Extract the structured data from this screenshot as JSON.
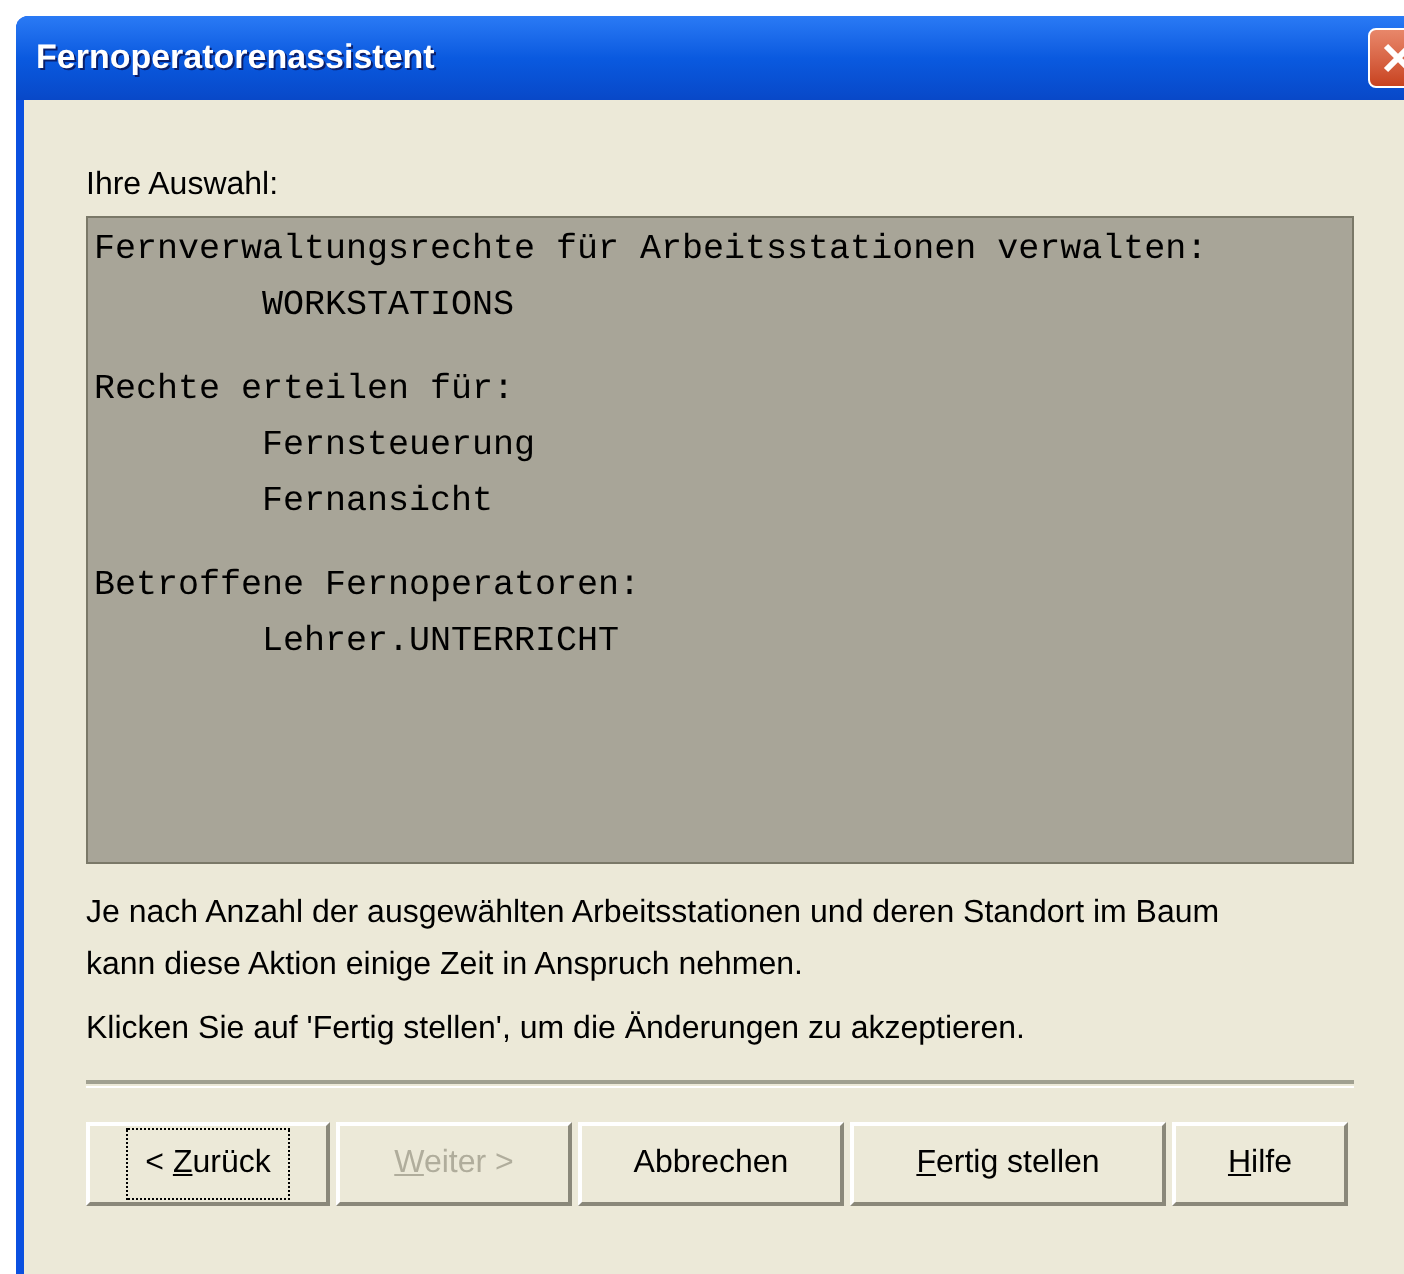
{
  "window": {
    "title": "Fernoperatorenassistent"
  },
  "selection_label": "Ihre Auswahl:",
  "summary": [
    {
      "heading": "Fernverwaltungsrechte für Arbeitsstationen verwalten:",
      "items": [
        "WORKSTATIONS"
      ]
    },
    {
      "heading": "Rechte erteilen für:",
      "items": [
        "Fernsteuerung",
        "Fernansicht"
      ]
    },
    {
      "heading": "Betroffene Fernoperatoren:",
      "items": [
        "Lehrer.UNTERRICHT"
      ]
    }
  ],
  "info_text": "Je nach Anzahl der ausgewählten Arbeitsstationen und deren Standort im Baum kann diese Aktion einige Zeit in Anspruch nehmen.",
  "hint_text": "Klicken Sie auf 'Fertig stellen', um die Änderungen zu akzeptieren.",
  "buttons": [
    {
      "before": "< ",
      "key": "Z",
      "after": "urück",
      "disabled": false,
      "focused": true
    },
    {
      "key": "W",
      "after": "eiter >",
      "disabled": true,
      "focused": false
    },
    {
      "before": "Abbrechen",
      "disabled": false,
      "focused": false
    },
    {
      "key": "F",
      "after": "ertig stellen",
      "disabled": false,
      "focused": false
    },
    {
      "key": "H",
      "after": "ilfe",
      "disabled": false,
      "focused": false
    }
  ]
}
